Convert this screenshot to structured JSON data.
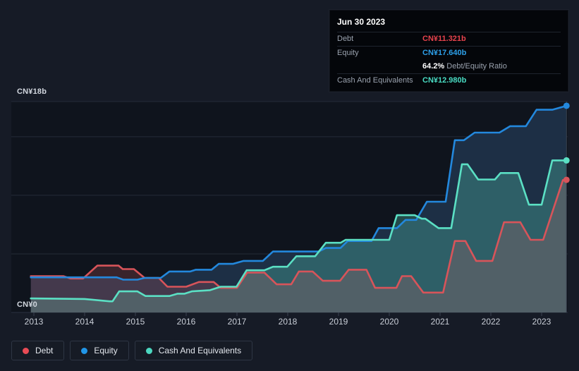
{
  "page": {
    "background": "#161b26",
    "plot_background": "#0f141d"
  },
  "tooltip": {
    "date": "Jun 30 2023",
    "debt_label": "Debt",
    "debt_value": "CN¥11.321b",
    "debt_color": "#e8434d",
    "equity_label": "Equity",
    "equity_value": "CN¥17.640b",
    "equity_color": "#2da0ea",
    "ratio_bold": "64.2%",
    "ratio_label": " Debt/Equity Ratio",
    "cash_label": "Cash And Equivalents",
    "cash_value": "CN¥12.980b",
    "cash_color": "#49dcc3"
  },
  "legend": {
    "items": [
      {
        "label": "Debt",
        "color": "#e84b55"
      },
      {
        "label": "Equity",
        "color": "#2196e8"
      },
      {
        "label": "Cash And Equivalents",
        "color": "#4cd7c0"
      }
    ]
  },
  "chart_data": {
    "type": "area",
    "title": "Debt to Equity History",
    "currency": "CN¥",
    "unit": "b",
    "y_axis": {
      "top_label": "CN¥18b",
      "bottom_label": "CN¥0",
      "min": 0,
      "max": 18,
      "gridline_values": [
        18,
        15,
        10,
        5,
        0
      ]
    },
    "x_axis": {
      "ticks": [
        2013,
        2014,
        2015,
        2016,
        2017,
        2018,
        2019,
        2020,
        2021,
        2022,
        2023
      ]
    },
    "crosshair_x": 2023.49,
    "series": [
      {
        "name": "Debt",
        "color": "#d8545a",
        "fill": "rgba(226,100,105,0.20)",
        "end_value": 11.321,
        "points": [
          [
            2012.94,
            3.1
          ],
          [
            2013.58,
            3.1
          ],
          [
            2013.72,
            2.9
          ],
          [
            2013.97,
            2.9
          ],
          [
            2014.25,
            4.0
          ],
          [
            2014.67,
            4.0
          ],
          [
            2014.75,
            3.7
          ],
          [
            2014.97,
            3.7
          ],
          [
            2015.18,
            2.95
          ],
          [
            2015.46,
            2.95
          ],
          [
            2015.63,
            2.2
          ],
          [
            2016.0,
            2.2
          ],
          [
            2016.25,
            2.6
          ],
          [
            2016.54,
            2.6
          ],
          [
            2016.68,
            2.1
          ],
          [
            2017.0,
            2.1
          ],
          [
            2017.2,
            3.4
          ],
          [
            2017.54,
            3.4
          ],
          [
            2017.78,
            2.4
          ],
          [
            2018.07,
            2.4
          ],
          [
            2018.22,
            3.5
          ],
          [
            2018.49,
            3.5
          ],
          [
            2018.69,
            2.7
          ],
          [
            2019.03,
            2.7
          ],
          [
            2019.2,
            3.65
          ],
          [
            2019.55,
            3.65
          ],
          [
            2019.72,
            2.1
          ],
          [
            2020.14,
            2.1
          ],
          [
            2020.25,
            3.1
          ],
          [
            2020.43,
            3.1
          ],
          [
            2020.67,
            1.7
          ],
          [
            2021.06,
            1.7
          ],
          [
            2021.29,
            6.1
          ],
          [
            2021.5,
            6.1
          ],
          [
            2021.71,
            4.4
          ],
          [
            2022.03,
            4.4
          ],
          [
            2022.26,
            7.7
          ],
          [
            2022.58,
            7.7
          ],
          [
            2022.78,
            6.2
          ],
          [
            2023.03,
            6.2
          ],
          [
            2023.42,
            11.3
          ],
          [
            2023.49,
            11.321
          ]
        ]
      },
      {
        "name": "Equity",
        "color": "#2388dd",
        "fill": "#1d2f45",
        "end_value": 17.64,
        "points": [
          [
            2012.94,
            3.0
          ],
          [
            2014.63,
            3.0
          ],
          [
            2014.76,
            2.8
          ],
          [
            2015.04,
            2.8
          ],
          [
            2015.18,
            2.95
          ],
          [
            2015.5,
            2.95
          ],
          [
            2015.67,
            3.5
          ],
          [
            2016.08,
            3.5
          ],
          [
            2016.19,
            3.65
          ],
          [
            2016.5,
            3.65
          ],
          [
            2016.64,
            4.15
          ],
          [
            2016.92,
            4.15
          ],
          [
            2017.13,
            4.4
          ],
          [
            2017.51,
            4.4
          ],
          [
            2017.71,
            5.2
          ],
          [
            2018.61,
            5.2
          ],
          [
            2018.75,
            5.5
          ],
          [
            2019.04,
            5.5
          ],
          [
            2019.18,
            6.1
          ],
          [
            2019.65,
            6.1
          ],
          [
            2019.79,
            7.2
          ],
          [
            2020.15,
            7.2
          ],
          [
            2020.32,
            7.9
          ],
          [
            2020.53,
            7.9
          ],
          [
            2020.74,
            9.45
          ],
          [
            2021.11,
            9.45
          ],
          [
            2021.29,
            14.7
          ],
          [
            2021.47,
            14.7
          ],
          [
            2021.68,
            15.35
          ],
          [
            2022.17,
            15.35
          ],
          [
            2022.38,
            15.9
          ],
          [
            2022.69,
            15.9
          ],
          [
            2022.9,
            17.3
          ],
          [
            2023.21,
            17.3
          ],
          [
            2023.49,
            17.64
          ]
        ]
      },
      {
        "name": "Cash And Equivalents",
        "color": "#5be0c4",
        "fill": "rgba(94,224,196,0.27)",
        "end_value": 12.98,
        "points": [
          [
            2012.94,
            1.2
          ],
          [
            2014.0,
            1.15
          ],
          [
            2014.49,
            0.95
          ],
          [
            2014.55,
            0.95
          ],
          [
            2014.68,
            1.8
          ],
          [
            2015.04,
            1.8
          ],
          [
            2015.2,
            1.4
          ],
          [
            2015.67,
            1.4
          ],
          [
            2015.83,
            1.6
          ],
          [
            2015.97,
            1.6
          ],
          [
            2016.11,
            1.8
          ],
          [
            2016.47,
            1.9
          ],
          [
            2016.68,
            2.2
          ],
          [
            2016.99,
            2.2
          ],
          [
            2017.19,
            3.6
          ],
          [
            2017.54,
            3.6
          ],
          [
            2017.71,
            3.9
          ],
          [
            2017.99,
            3.9
          ],
          [
            2018.17,
            4.8
          ],
          [
            2018.54,
            4.8
          ],
          [
            2018.75,
            5.95
          ],
          [
            2019.04,
            5.95
          ],
          [
            2019.14,
            6.2
          ],
          [
            2020.0,
            6.2
          ],
          [
            2020.15,
            8.3
          ],
          [
            2020.5,
            8.3
          ],
          [
            2020.64,
            8.0
          ],
          [
            2020.71,
            8.0
          ],
          [
            2020.97,
            7.2
          ],
          [
            2021.22,
            7.2
          ],
          [
            2021.43,
            12.65
          ],
          [
            2021.54,
            12.65
          ],
          [
            2021.75,
            11.35
          ],
          [
            2022.08,
            11.35
          ],
          [
            2022.19,
            11.9
          ],
          [
            2022.54,
            11.9
          ],
          [
            2022.75,
            9.2
          ],
          [
            2023.0,
            9.2
          ],
          [
            2023.21,
            12.98
          ],
          [
            2023.49,
            12.98
          ]
        ]
      }
    ]
  }
}
